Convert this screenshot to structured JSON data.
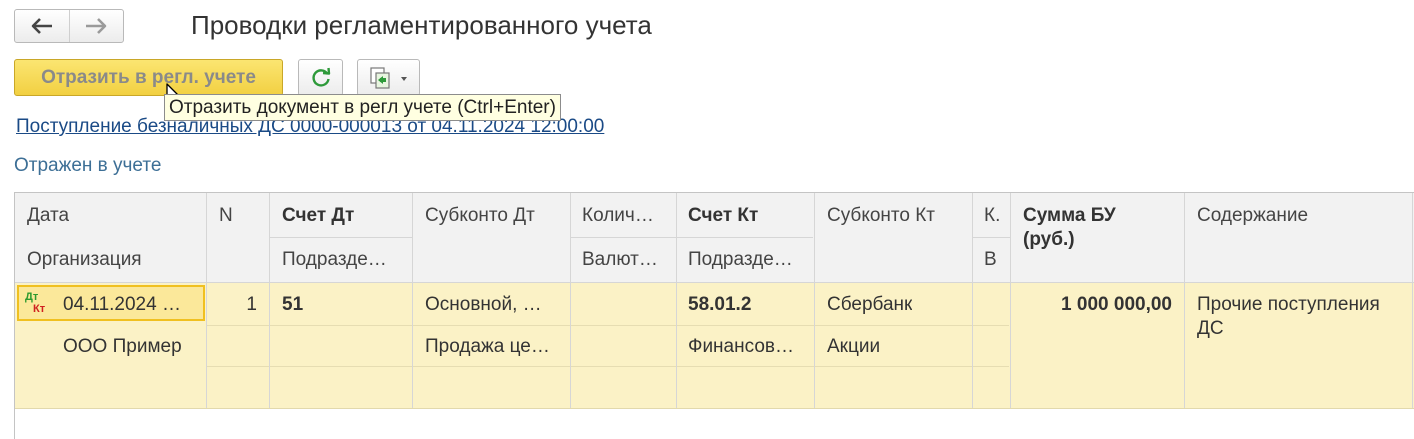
{
  "window": {
    "title": "Проводки регламентированного учета"
  },
  "nav": {
    "back_icon": "arrow-left-icon",
    "forward_icon": "arrow-right-icon"
  },
  "toolbar": {
    "post_label": "Отразить в регл. учете",
    "refresh_icon": "refresh-icon",
    "more_icon": "report-dropdown-icon"
  },
  "tooltip": {
    "text": "Отразить документ в регл учете (Ctrl+Enter)"
  },
  "document": {
    "link": "Поступление безналичных ДС 0000-000013 от 04.11.2024 12:00:00",
    "status": "Отражен в учете"
  },
  "table": {
    "headers": {
      "date": "Дата",
      "organization": "Организация",
      "n": "N",
      "account_dt": "Счет Дт",
      "division_dt": "Подразде…",
      "subconto_dt": "Субконто Дт",
      "quantity": "Колич…",
      "currency": "Валют…",
      "account_kt": "Счет Кт",
      "division_kt": "Подразде…",
      "subconto_kt": "Субконто Кт",
      "k": "К.",
      "v": "В",
      "amount": "Сумма БУ (руб.)",
      "amount_line1": "Сумма БУ",
      "amount_line2": "(руб.)",
      "content": "Содержание"
    },
    "rows": [
      {
        "icon_dt": "Дт",
        "icon_kt": "Кт",
        "date": "04.11.2024 …",
        "organization": "ООО Пример",
        "n": "1",
        "account_dt": "51",
        "subconto_dt_1": "Основной, …",
        "subconto_dt_2": "Продажа це…",
        "account_kt": "58.01.2",
        "division_kt": "Финансов…",
        "subconto_kt_1": "Сбербанк",
        "subconto_kt_2": "Акции",
        "amount": "1 000 000,00",
        "content_line1": "Прочие поступления",
        "content_line2": "ДС"
      }
    ]
  },
  "colors": {
    "primary_button": "#f2d042",
    "row_highlight": "#fbf2c6",
    "header_bg": "#f2f2f2",
    "link": "#1a4a86",
    "status": "#3d6f96",
    "tooltip_bg": "#ffffe1"
  }
}
